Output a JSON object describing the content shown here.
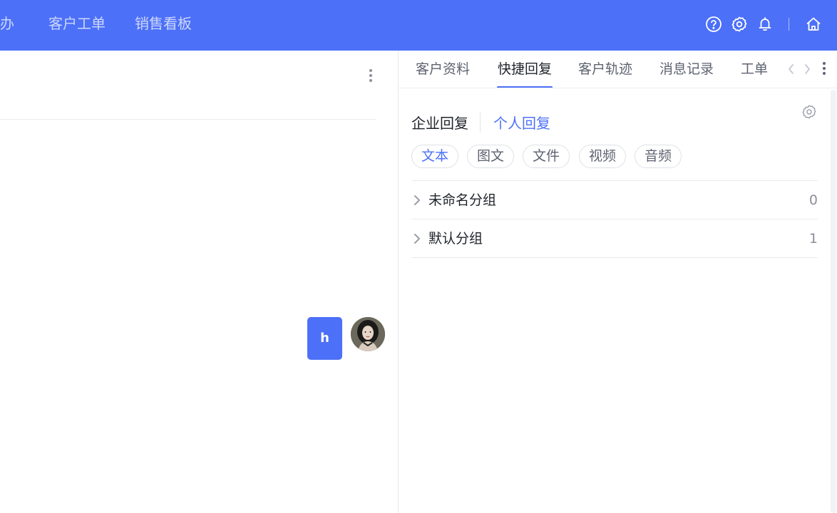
{
  "topnav": {
    "items": [
      "待办",
      "客户工单",
      "销售看板"
    ],
    "icons": [
      "help-circle-icon",
      "gear-icon",
      "bell-icon",
      "home-icon"
    ],
    "accent": "#4c70f8"
  },
  "chat": {
    "message_text": "h"
  },
  "panel": {
    "tabs": [
      "客户资料",
      "快捷回复",
      "客户轨迹",
      "消息记录",
      "工单"
    ],
    "active_tab": "快捷回复",
    "sub_tabs": [
      "企业回复",
      "个人回复"
    ],
    "active_sub_tab": "个人回复",
    "filters": [
      "文本",
      "图文",
      "文件",
      "视频",
      "音频"
    ],
    "active_filter": "文本",
    "groups": [
      {
        "name": "未命名分组",
        "count": "0"
      },
      {
        "name": "默认分组",
        "count": "1"
      }
    ]
  }
}
